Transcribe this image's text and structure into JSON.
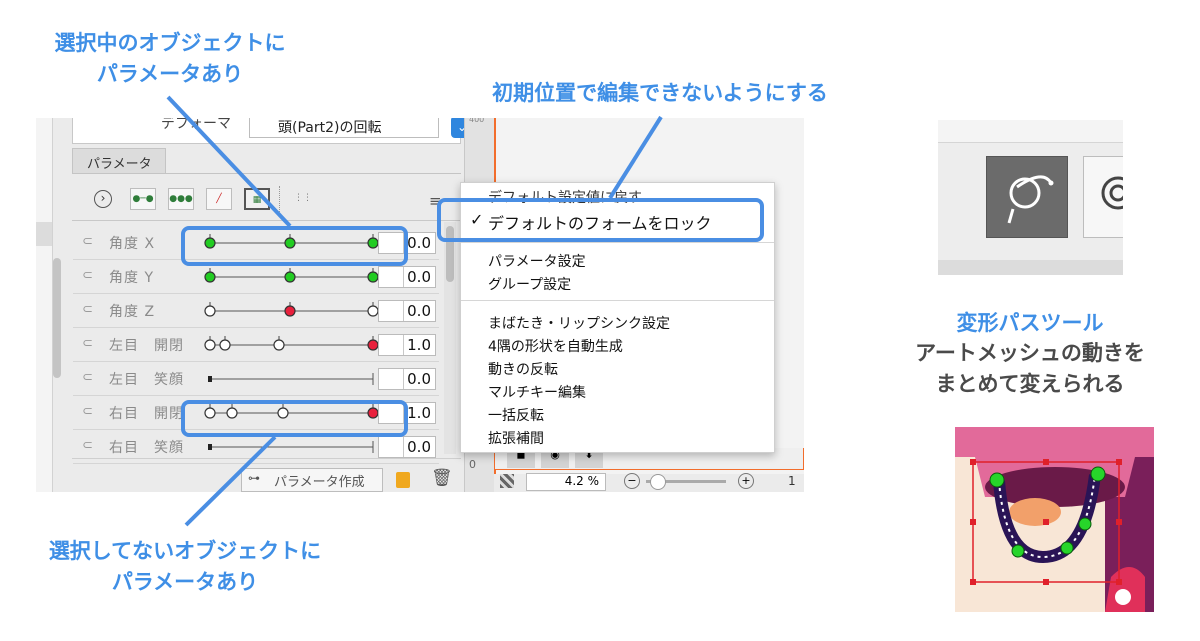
{
  "annotations": {
    "top_left": [
      "選択中のオブジェクトに",
      "パラメータあり"
    ],
    "top_center": "初期位置で編集できないようにする",
    "bottom_left": [
      "選択してないオブジェクトに",
      "パラメータあり"
    ],
    "right_title": "変形パスツール",
    "right_desc": [
      "アートメッシュの動きを",
      "まとめて変えられる"
    ]
  },
  "deformer": {
    "label": "デフォーマ",
    "value": "頭(Part2)の回転"
  },
  "panel": {
    "tab": "パラメータ",
    "create_button": "パラメータ作成",
    "ruler_mark": "400",
    "rows": [
      {
        "label": "角度 X",
        "value": "0.0"
      },
      {
        "label": "角度 Y",
        "value": "0.0"
      },
      {
        "label": "角度 Z",
        "value": "0.0"
      },
      {
        "label": "左目　開閉",
        "value": "1.0"
      },
      {
        "label": "左目　笑顔",
        "value": "0.0"
      },
      {
        "label": "右目　開閉",
        "value": "1.0"
      },
      {
        "label": "右目　笑顔",
        "value": "0.0"
      }
    ]
  },
  "menu": {
    "items": [
      "デフォルト設定値に戻す",
      "デフォルトのフォームをロック",
      "パラメータ設定",
      "グループ設定",
      "まばたき・リップシンク設定",
      "4隅の形状を自動生成",
      "動きの反転",
      "マルチキー編集",
      "一括反転",
      "拡張補間"
    ],
    "checked_item": "デフォルトのフォームをロック",
    "check_glyph": "✓"
  },
  "canvas_status": {
    "zoom": "4.2 %",
    "frame_zero": "0",
    "zoom_out": "−",
    "zoom_in": "+",
    "trailing": "1"
  },
  "colors": {
    "annotation_blue": "#3f8fe6",
    "key_green": "#22cc22",
    "key_red": "#e8203c",
    "canvas_orange": "#f26d2c"
  }
}
